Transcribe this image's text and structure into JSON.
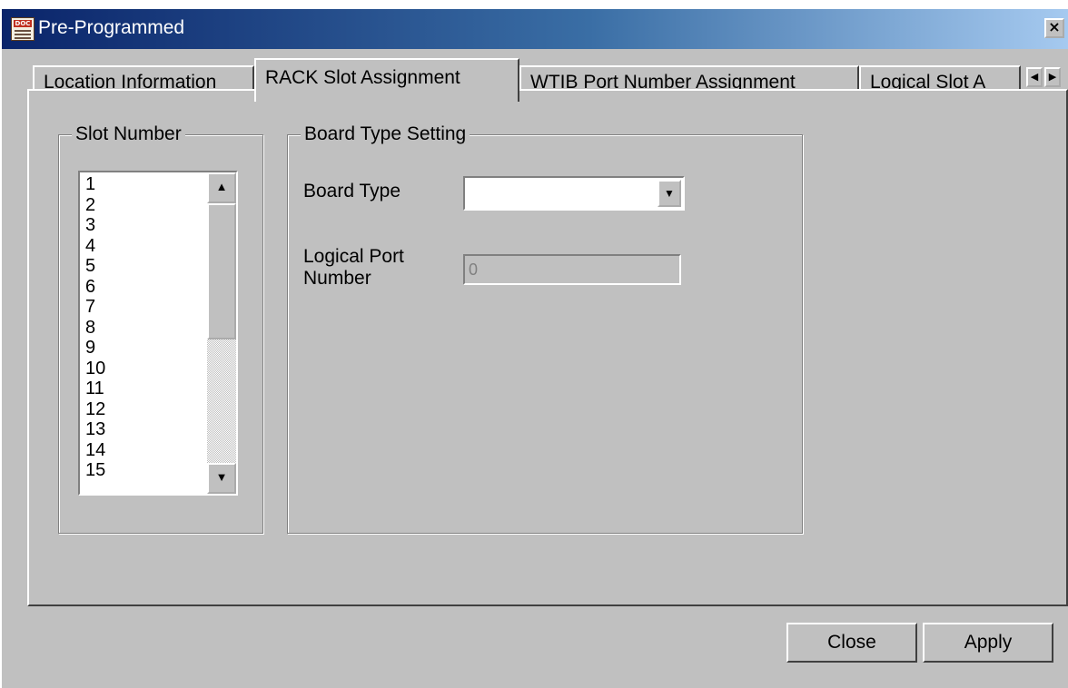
{
  "window": {
    "title": "Pre-Programmed",
    "close_glyph": "×"
  },
  "tabs": [
    {
      "label": "Location Information",
      "active": false
    },
    {
      "label": "RACK Slot Assignment",
      "active": true
    },
    {
      "label": "WTIB Port Number Assignment",
      "active": false
    },
    {
      "label": "Logical Slot A",
      "active": false
    }
  ],
  "tab_scroll": {
    "left": "◀",
    "right": "▶"
  },
  "slot_group": {
    "label": "Slot Number",
    "items": [
      "1",
      "2",
      "3",
      "4",
      "5",
      "6",
      "7",
      "8",
      "9",
      "10",
      "11",
      "12",
      "13",
      "14",
      "15"
    ]
  },
  "scrollbar": {
    "up": "▲",
    "down": "▼"
  },
  "board_group": {
    "label": "Board Type Setting",
    "board_type_label": "Board Type",
    "board_type_value": "",
    "dropdown_glyph": "▼",
    "logical_port_label_line1": "Logical Port",
    "logical_port_label_line2": "Number",
    "logical_port_value": "0"
  },
  "buttons": {
    "close": "Close",
    "apply": "Apply"
  },
  "icons": {
    "app": "doc-app-icon",
    "title_close": "close-icon"
  }
}
